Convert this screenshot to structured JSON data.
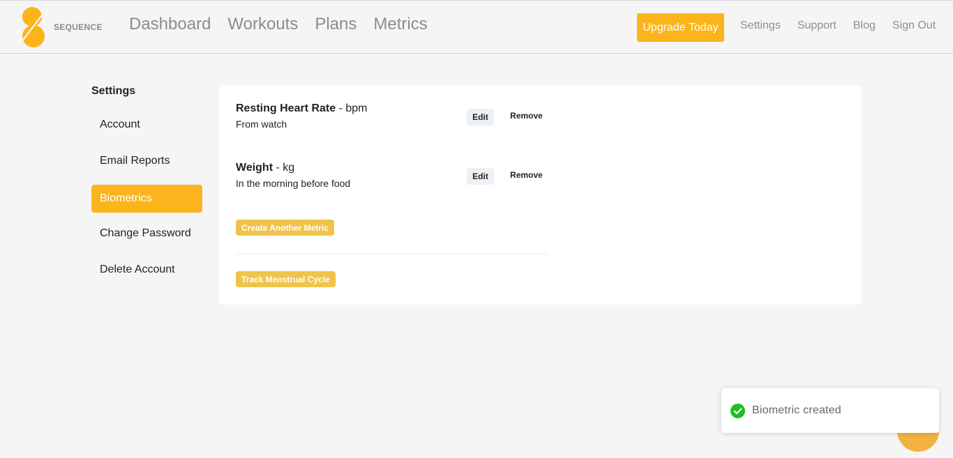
{
  "brand": {
    "name": "SEQUENCE",
    "color": "#fbb41c"
  },
  "main_nav": [
    "Dashboard",
    "Workouts",
    "Plans",
    "Metrics"
  ],
  "upgrade_label": "Upgrade Today",
  "right_nav": [
    "Settings",
    "Support",
    "Blog",
    "Sign Out"
  ],
  "sidebar": {
    "title": "Settings",
    "items": [
      {
        "label": "Account",
        "active": false
      },
      {
        "label": "Email Reports",
        "active": false
      },
      {
        "label": "Biometrics",
        "active": true
      },
      {
        "label": "Change Password",
        "active": false
      },
      {
        "label": "Delete Account",
        "active": false
      }
    ]
  },
  "metrics": [
    {
      "name": "Resting Heart Rate",
      "unit": " - bpm",
      "description": "From watch",
      "edit_label": "Edit",
      "remove_label": "Remove"
    },
    {
      "name": "Weight",
      "unit": " - kg",
      "description": "In the morning before food",
      "edit_label": "Edit",
      "remove_label": "Remove"
    }
  ],
  "create_metric_label": "Create Another Metric",
  "track_cycle_label": "Track Menstrual Cycle",
  "toast": {
    "text": "Biometric created",
    "icon": "check-circle-icon",
    "icon_color": "#1ec01e"
  },
  "chat": {
    "icon": "chat-bubble-icon"
  }
}
